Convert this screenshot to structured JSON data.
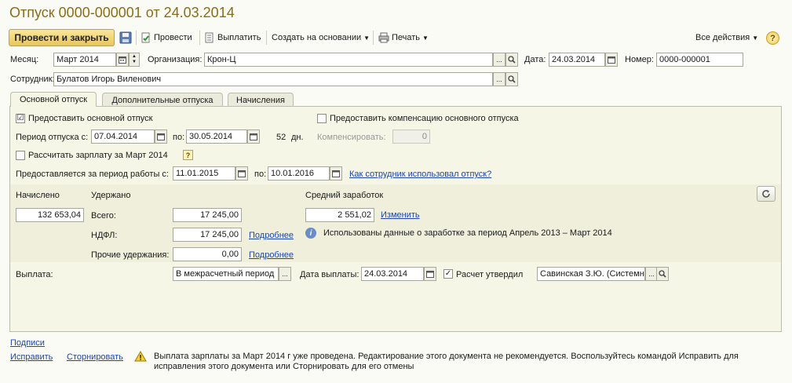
{
  "window": {
    "title": "Отпуск 0000-000001 от 24.03.2014"
  },
  "toolbar": {
    "post_close": "Провести и закрыть",
    "post": "Провести",
    "pay": "Выплатить",
    "create_based": "Создать на основании",
    "print": "Печать",
    "all_actions": "Все действия",
    "help": "?"
  },
  "header": {
    "month_label": "Месяц:",
    "month_value": "Март 2014",
    "org_label": "Организация:",
    "org_value": "Крон-Ц",
    "date_label": "Дата:",
    "date_value": "24.03.2014",
    "number_label": "Номер:",
    "number_value": "0000-000001",
    "employee_label": "Сотрудник:",
    "employee_value": "Булатов Игорь Виленович"
  },
  "tabs": [
    {
      "label": "Основной отпуск"
    },
    {
      "label": "Дополнительные отпуска"
    },
    {
      "label": "Начисления"
    }
  ],
  "main": {
    "provide_main_label": "Предоставить основной отпуск",
    "provide_main_checked": "☑",
    "provide_comp_label": "Предоставить компенсацию основного отпуска",
    "period_label": "Период отпуска с:",
    "period_from": "07.04.2014",
    "period_to_label": "по:",
    "period_to": "30.05.2014",
    "days_value": "52",
    "days_unit": "дн.",
    "compensate_label": "Компенсировать:",
    "compensate_value": "0",
    "calc_salary_label": "Рассчитать зарплату за Март 2014",
    "qmark": "?",
    "work_period_label": "Предоставляется за период работы с:",
    "work_from": "11.01.2015",
    "work_to_label": "по:",
    "work_to": "10.01.2016",
    "how_used_link": "Как сотрудник использовал отпуск?"
  },
  "calc": {
    "accrued_label": "Начислено",
    "accrued_value": "132 653,04",
    "withheld_label": "Удержано",
    "total_label": "Всего:",
    "total_value": "17 245,00",
    "ndfl_label": "НДФЛ:",
    "ndfl_value": "17 245,00",
    "more1": "Подробнее",
    "other_label": "Прочие удержания:",
    "other_value": "0,00",
    "more2": "Подробнее",
    "avg_label": "Средний заработок",
    "avg_value": "2 551,02",
    "change_link": "Изменить",
    "info_text": "Использованы данные о заработке за период Апрель 2013 – Март 2014"
  },
  "payment": {
    "label": "Выплата:",
    "value": "В межрасчетный период",
    "date_label": "Дата выплаты:",
    "date_value": "24.03.2014",
    "approved_label": "Расчет утвердил",
    "approved_checked": "✓",
    "approver_value": "Савинская З.Ю. (Системный"
  },
  "footer": {
    "signatures": "Подписи",
    "fix": "Исправить",
    "reverse": "Сторнировать",
    "warning": "Выплата зарплаты за Март 2014 г уже проведена. Редактирование этого документа не рекомендуется. Воспользуйтесь командой Исправить для исправления этого документа или Сторнировать для его отмены"
  }
}
